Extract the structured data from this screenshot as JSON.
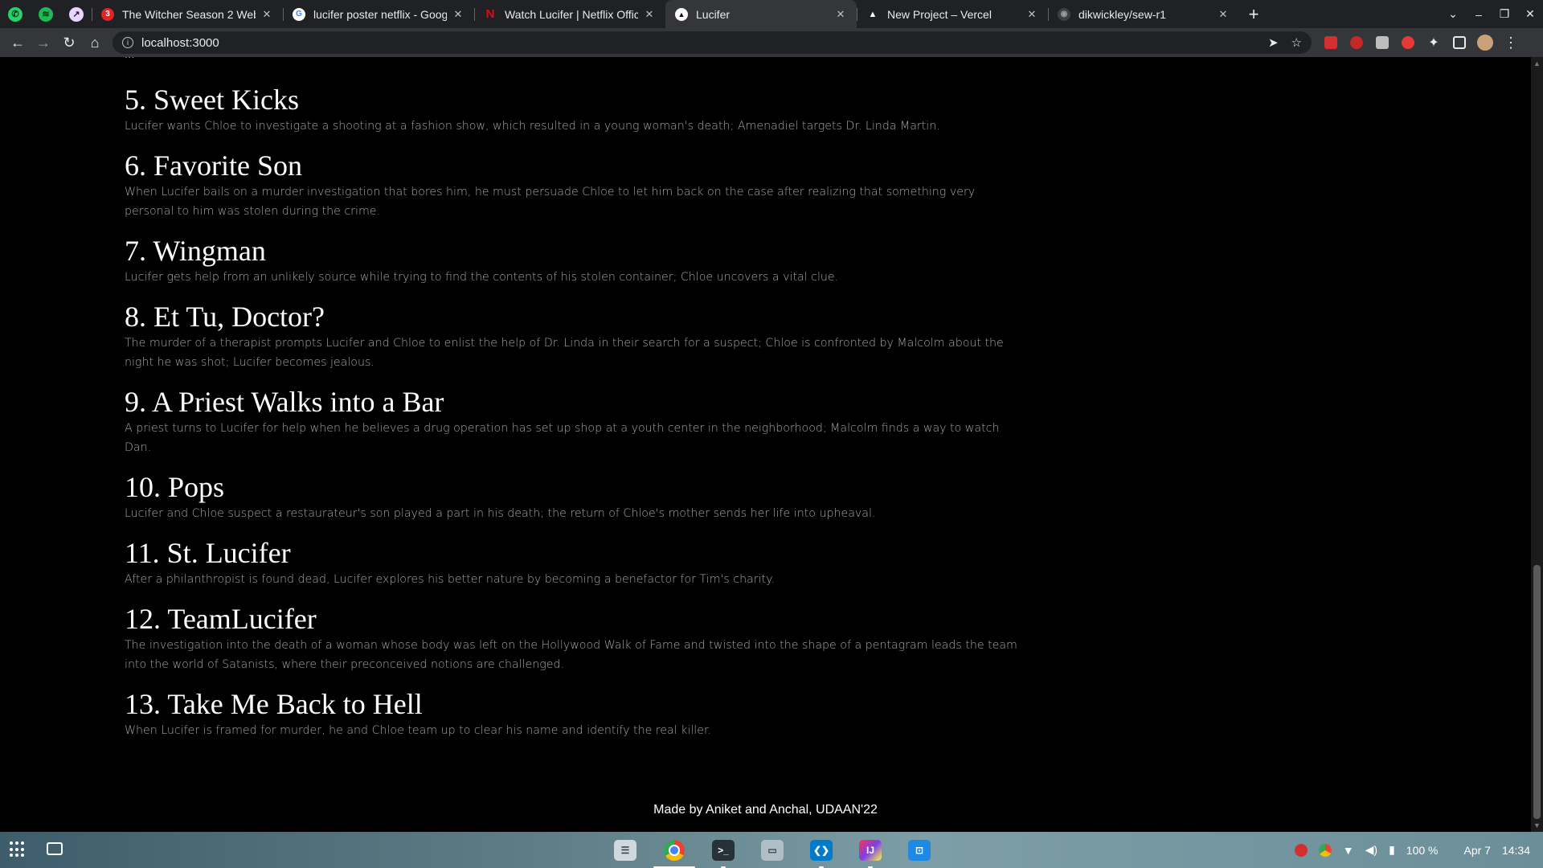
{
  "browser": {
    "pinned_tabs": [
      {
        "icon": "whatsapp-icon",
        "color": "#25d366"
      },
      {
        "icon": "spotify-icon",
        "color": "#1db954"
      },
      {
        "icon": "rocket-icon",
        "color": "#e9d5ff"
      }
    ],
    "tabs": [
      {
        "title": "The Witcher Season 2 Web",
        "icon": "360-icon",
        "color": "#e02424",
        "active": false
      },
      {
        "title": "lucifer poster netflix - Goog",
        "icon": "google-icon",
        "color": "#ffffff",
        "active": false
      },
      {
        "title": "Watch Lucifer | Netflix Offic",
        "icon": "netflix-icon",
        "color": "#e50914",
        "active": false
      },
      {
        "title": "Lucifer",
        "icon": "vercel-icon",
        "color": "#ffffff",
        "active": true
      },
      {
        "title": "New Project – Vercel",
        "icon": "vercel-icon",
        "color": "#ffffff",
        "active": false
      },
      {
        "title": "dikwickley/sew-r1",
        "icon": "github-icon",
        "color": "#9aa0a6",
        "active": false
      }
    ],
    "url": "localhost:3000"
  },
  "page": {
    "partial_line": "...",
    "episodes": [
      {
        "title": "5. Sweet Kicks",
        "description": "Lucifer wants Chloe to investigate a shooting at a fashion show, which resulted in a young woman's death; Amenadiel targets Dr. Linda Martin."
      },
      {
        "title": "6. Favorite Son",
        "description": "When Lucifer bails on a murder investigation that bores him, he must persuade Chloe to let him back on the case after realizing that something very personal to him was stolen during the crime."
      },
      {
        "title": "7. Wingman",
        "description": "Lucifer gets help from an unlikely source while trying to find the contents of his stolen container; Chloe uncovers a vital clue."
      },
      {
        "title": "8. Et Tu, Doctor?",
        "description": "The murder of a therapist prompts Lucifer and Chloe to enlist the help of Dr. Linda in their search for a suspect; Chloe is confronted by Malcolm about the night he was shot; Lucifer becomes jealous."
      },
      {
        "title": "9. A Priest Walks into a Bar",
        "description": "A priest turns to Lucifer for help when he believes a drug operation has set up shop at a youth center in the neighborhood; Malcolm finds a way to watch Dan."
      },
      {
        "title": "10. Pops",
        "description": "Lucifer and Chloe suspect a restaurateur's son played a part in his death; the return of Chloe's mother sends her life into upheaval."
      },
      {
        "title": "11. St. Lucifer",
        "description": "After a philanthropist is found dead, Lucifer explores his better nature by becoming a benefactor for Tim's charity."
      },
      {
        "title": "12. TeamLucifer",
        "description": "The investigation into the death of a woman whose body was left on the Hollywood Walk of Fame and twisted into the shape of a pentagram leads the team into the world of Satanists, where their preconceived notions are challenged."
      },
      {
        "title": "13. Take Me Back to Hell",
        "description": "When Lucifer is framed for murder, he and Chloe team up to clear his name and identify the real killer."
      }
    ],
    "footer": "Made by Aniket and Anchal, UDAAN'22"
  },
  "shelf": {
    "apps": [
      {
        "icon": "files-list-icon",
        "color": "#cfd8dc"
      },
      {
        "icon": "chrome-icon",
        "color": "#fbbc04"
      },
      {
        "icon": "terminal-icon",
        "color": "#263238"
      },
      {
        "icon": "folder-icon",
        "color": "#b0bec5"
      },
      {
        "icon": "vscode-icon",
        "color": "#007acc"
      },
      {
        "icon": "intellij-icon",
        "color": "#fe315d"
      },
      {
        "icon": "store-icon",
        "color": "#1e88e5"
      }
    ],
    "battery": "100 %",
    "date": "Apr 7",
    "time": "14:34"
  }
}
